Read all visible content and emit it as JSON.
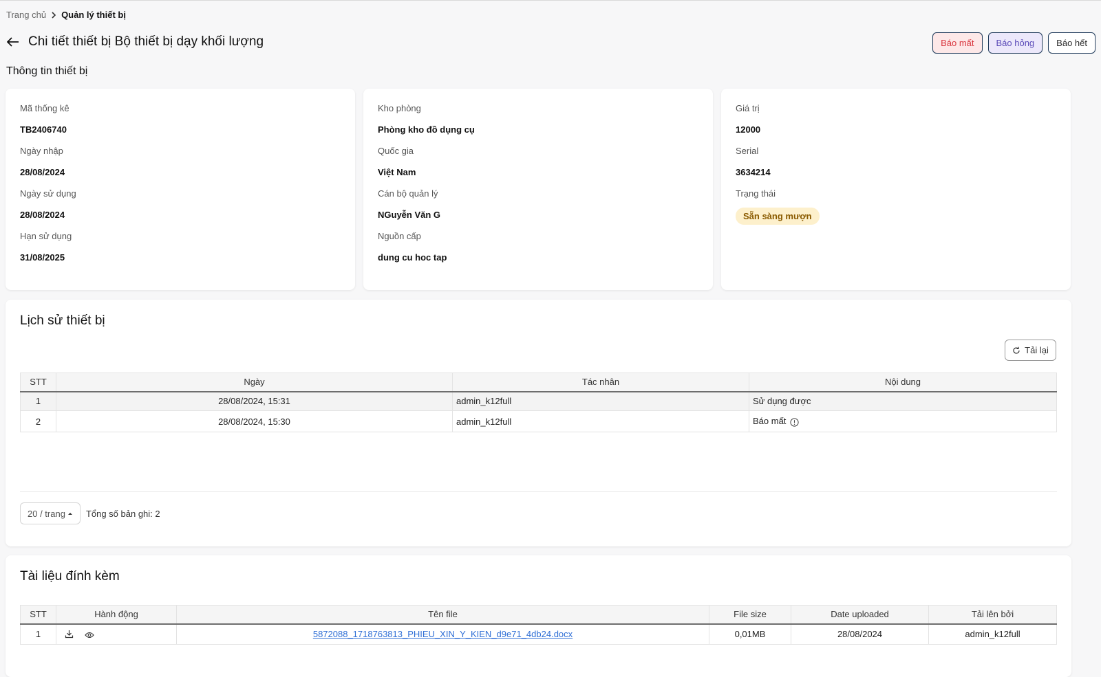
{
  "breadcrumb": {
    "home": "Trang chủ",
    "current": "Quản lý thiết bị"
  },
  "header": {
    "title": "Chi tiết thiết bị Bộ thiết bị dạy khối lượng"
  },
  "actions": {
    "lost": "Báo mất",
    "broken": "Báo hỏng",
    "out": "Báo hết"
  },
  "info": {
    "section_title": "Thông tin thiết bị",
    "col1": [
      {
        "label": "Mã thống kê",
        "value": "TB2406740"
      },
      {
        "label": "Ngày nhập",
        "value": "28/08/2024"
      },
      {
        "label": "Ngày sử dụng",
        "value": "28/08/2024"
      },
      {
        "label": "Hạn sử dụng",
        "value": "31/08/2025"
      }
    ],
    "col2": [
      {
        "label": "Kho phòng",
        "value": "Phòng kho đồ dụng cụ"
      },
      {
        "label": "Quốc gia",
        "value": "Việt Nam"
      },
      {
        "label": "Cán bộ quản lý",
        "value": "NGuyễn Văn G"
      },
      {
        "label": "Nguồn cấp",
        "value": "dung cu hoc tap"
      }
    ],
    "col3": [
      {
        "label": "Giá trị",
        "value": "12000"
      },
      {
        "label": "Serial",
        "value": "3634214"
      },
      {
        "label": "Trạng thái",
        "value": "Sẵn sàng mượn"
      }
    ]
  },
  "history": {
    "title": "Lịch sử thiết bị",
    "reload_label": "Tải lại",
    "columns": [
      "STT",
      "Ngày",
      "Tác nhân",
      "Nội dung"
    ],
    "rows": [
      {
        "stt": "1",
        "date": "28/08/2024, 15:31",
        "actor": "admin_k12full",
        "content": "Sử dụng được"
      },
      {
        "stt": "2",
        "date": "28/08/2024, 15:30",
        "actor": "admin_k12full",
        "content": "Báo mất"
      }
    ],
    "page_size": "20 / trang",
    "total": "Tổng số bản ghi: 2"
  },
  "docs": {
    "title": "Tài liệu đính kèm",
    "columns": [
      "STT",
      "Hành động",
      "Tên file",
      "File size",
      "Date uploaded",
      "Tải lên bởi"
    ],
    "rows": [
      {
        "stt": "1",
        "file": "5872088_1718763813_PHIEU_XIN_Y_KIEN_d9e71_4db24.docx",
        "size": "0,01MB",
        "date": "28/08/2024",
        "by": "admin_k12full"
      }
    ]
  },
  "icons": {
    "back": "arrow-left-icon",
    "sep": "chevron-right-icon",
    "reload": "reload-icon",
    "info": "info-circle-icon",
    "download": "download-icon",
    "view": "eye-icon",
    "caret": "caret-up-icon"
  },
  "colors": {
    "lost_bg": "#fde8e8",
    "lost_text": "#d9363e",
    "broken_bg": "#ece8fb",
    "broken_text": "#5b4bb8",
    "badge_bg": "#fdf0cc",
    "badge_text": "#8a5a00",
    "link": "#2f6fd6"
  }
}
